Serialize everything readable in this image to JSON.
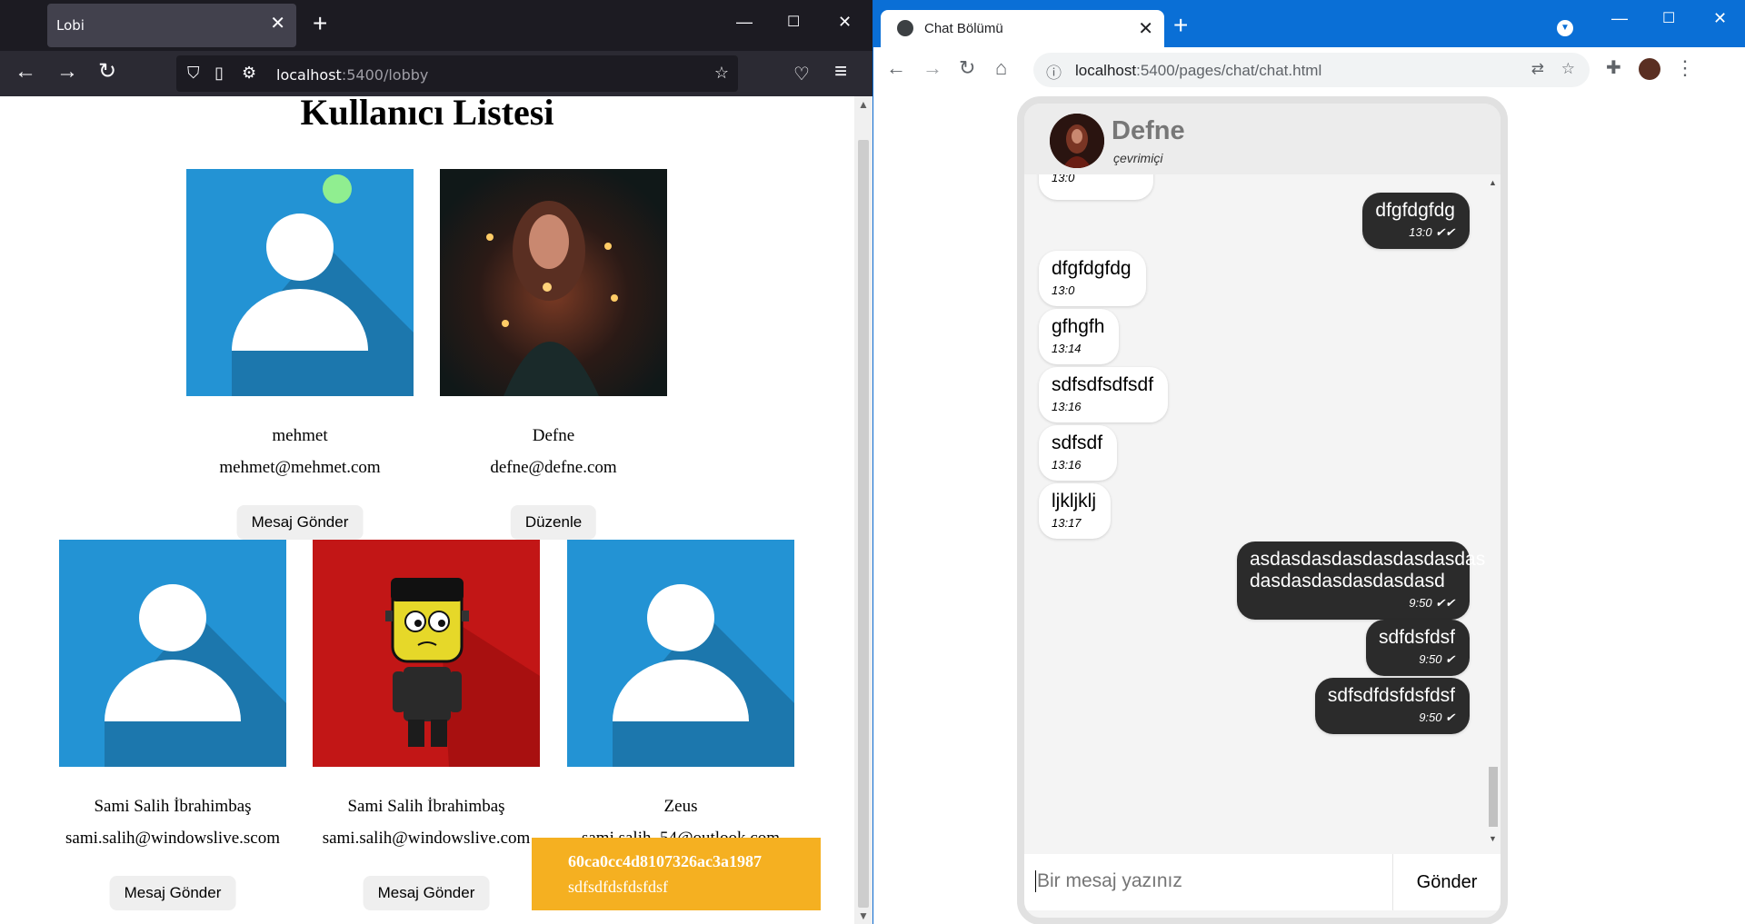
{
  "left_window": {
    "tab_title": "Lobi",
    "url_host": "localhost",
    "url_path": ":5400/lobby",
    "page_title": "Kullanıcı Listesi",
    "users": [
      {
        "name": "mehmet",
        "email": "mehmet@mehmet.com",
        "button": "Mesaj Gönder",
        "online": true,
        "avatar": "default-avatar-blue"
      },
      {
        "name": "Defne",
        "email": "defne@defne.com",
        "button": "Düzenle",
        "online": false,
        "avatar": "photo-candles"
      },
      {
        "name": "Sami Salih İbrahimbaş",
        "email": "sami.salih@windowslive.scom",
        "button": "Mesaj Gönder",
        "online": false,
        "avatar": "default-avatar-blue"
      },
      {
        "name": "Sami Salih İbrahimbaş",
        "email": "sami.salih@windowslive.com",
        "button": "Mesaj Gönder",
        "online": false,
        "avatar": "frankenstein-cartoon-red"
      },
      {
        "name": "Zeus",
        "email": "sami.salih_54@outlook.com",
        "button": "",
        "online": false,
        "avatar": "default-avatar-blue"
      }
    ],
    "notification": {
      "id": "60ca0cc4d8107326ac3a1987",
      "text": "sdfsdfdsfdsfdsf"
    }
  },
  "right_window": {
    "tab_title": "Chat Bölümü",
    "url_host": "localhost",
    "url_path": ":5400/pages/chat/chat.html",
    "contact": {
      "name": "Defne",
      "status": "çevrimiçi"
    },
    "partial_top_time": "13:0",
    "messages": [
      {
        "dir": "out",
        "text": "dfgfdgfdg",
        "time": "13:0 ✔✔"
      },
      {
        "dir": "in",
        "text": "dfgfdgfdg",
        "time": "13:0"
      },
      {
        "dir": "in",
        "text": "gfhgfh",
        "time": "13:14"
      },
      {
        "dir": "in",
        "text": "sdfsdfsdfsdf",
        "time": "13:16"
      },
      {
        "dir": "in",
        "text": "sdfsdf",
        "time": "13:16"
      },
      {
        "dir": "in",
        "text": "ljkljklj",
        "time": "13:17"
      },
      {
        "dir": "out",
        "text": "asdasdasdasdasdasdasdas dasdasdasdasdasdasd",
        "time": "9:50 ✔✔"
      },
      {
        "dir": "out",
        "text": "sdfdsfdsf",
        "time": "9:50 ✔"
      },
      {
        "dir": "out",
        "text": "sdfsdfdsfdsfdsf",
        "time": "9:50 ✔"
      }
    ],
    "input_placeholder": "Bir mesaj yazınız",
    "send_label": "Gönder"
  },
  "colors": {
    "avatar_blue": "#2393d4",
    "avatar_red": "#c21616",
    "online": "#90ee90",
    "toast": "#f5b021",
    "bubble_out": "#2b2b2b",
    "chrome_blue": "#0a6fd6"
  }
}
